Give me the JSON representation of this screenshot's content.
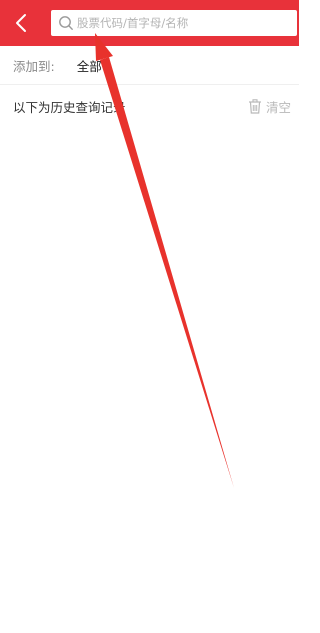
{
  "header": {
    "background_color": "#e8323a",
    "back_icon": "chevron-left-icon",
    "search": {
      "icon": "search-icon",
      "placeholder": "股票代码/首字母/名称",
      "value": ""
    }
  },
  "add_to": {
    "label": "添加到:",
    "value": "全部"
  },
  "history": {
    "title": "以下为历史查询记录",
    "clear_icon": "trash-icon",
    "clear_label": "清空"
  },
  "annotation": {
    "arrow_color": "#e8322c"
  }
}
